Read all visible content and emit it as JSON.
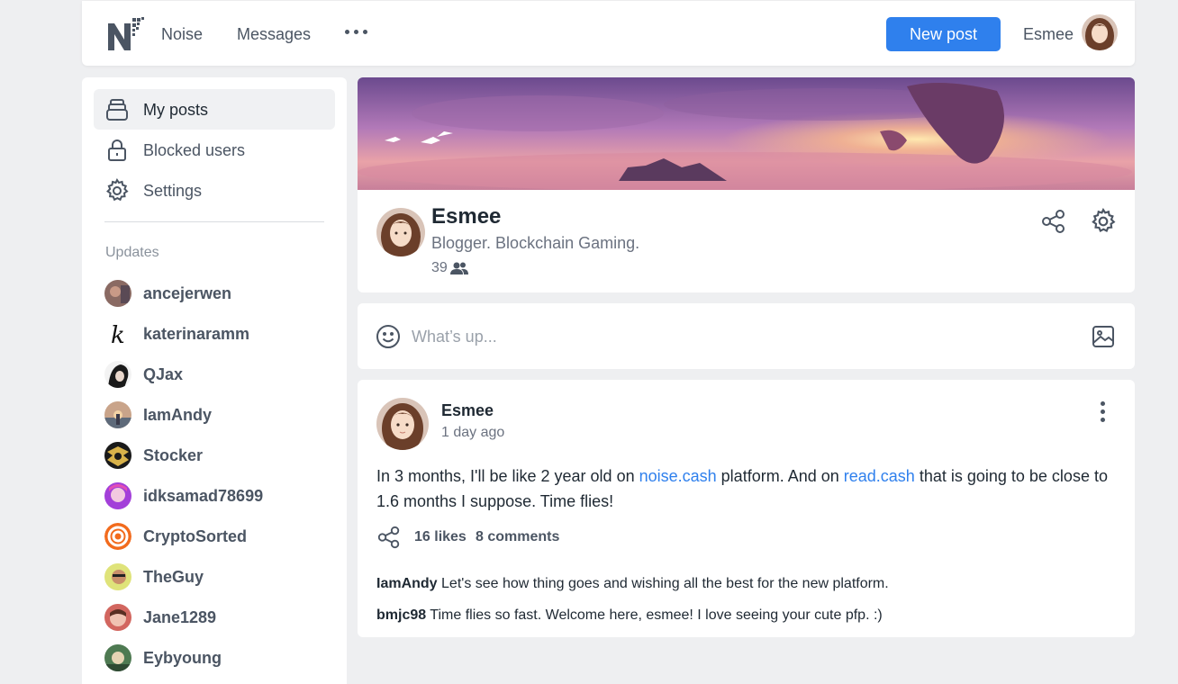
{
  "nav": {
    "noise_label": "Noise",
    "messages_label": "Messages",
    "new_post_label": "New post",
    "user_name": "Esmee"
  },
  "sidebar": {
    "items": [
      {
        "label": "My posts",
        "icon": "bookshelf-icon",
        "active": true
      },
      {
        "label": "Blocked users",
        "icon": "lock-icon",
        "active": false
      },
      {
        "label": "Settings",
        "icon": "gear-icon",
        "active": false
      }
    ],
    "updates_title": "Updates",
    "updates": [
      {
        "name": "ancejerwen"
      },
      {
        "name": "katerinaramm"
      },
      {
        "name": "QJax"
      },
      {
        "name": "IamAndy"
      },
      {
        "name": "Stocker"
      },
      {
        "name": "idksamad78699"
      },
      {
        "name": "CryptoSorted"
      },
      {
        "name": "TheGuy"
      },
      {
        "name": "Jane1289"
      },
      {
        "name": "Eybyoung"
      }
    ]
  },
  "profile": {
    "name": "Esmee",
    "bio": "Blogger. Blockchain Gaming.",
    "followers": "39"
  },
  "compose": {
    "placeholder": "What’s up..."
  },
  "post": {
    "author": "Esmee",
    "time": "1 day ago",
    "text_1": "In 3 months, I'll be like 2 year old on ",
    "link_1": "noise.cash",
    "text_2": " platform. And on ",
    "link_2": "read.cash",
    "text_3": " that is going to be close to 1.6 months I suppose. Time flies!",
    "likes": "16 likes",
    "comments": "8 comments",
    "comment_list": [
      {
        "user": "IamAndy",
        "text": " Let's see how thing goes and wishing all the best for the new platform."
      },
      {
        "user": "bmjc98",
        "text": " Time flies so fast. Welcome here, esmee! I love seeing your cute pfp. :)"
      }
    ]
  },
  "colors": {
    "accent": "#2f80ed",
    "page_bg": "#eeeff1"
  }
}
